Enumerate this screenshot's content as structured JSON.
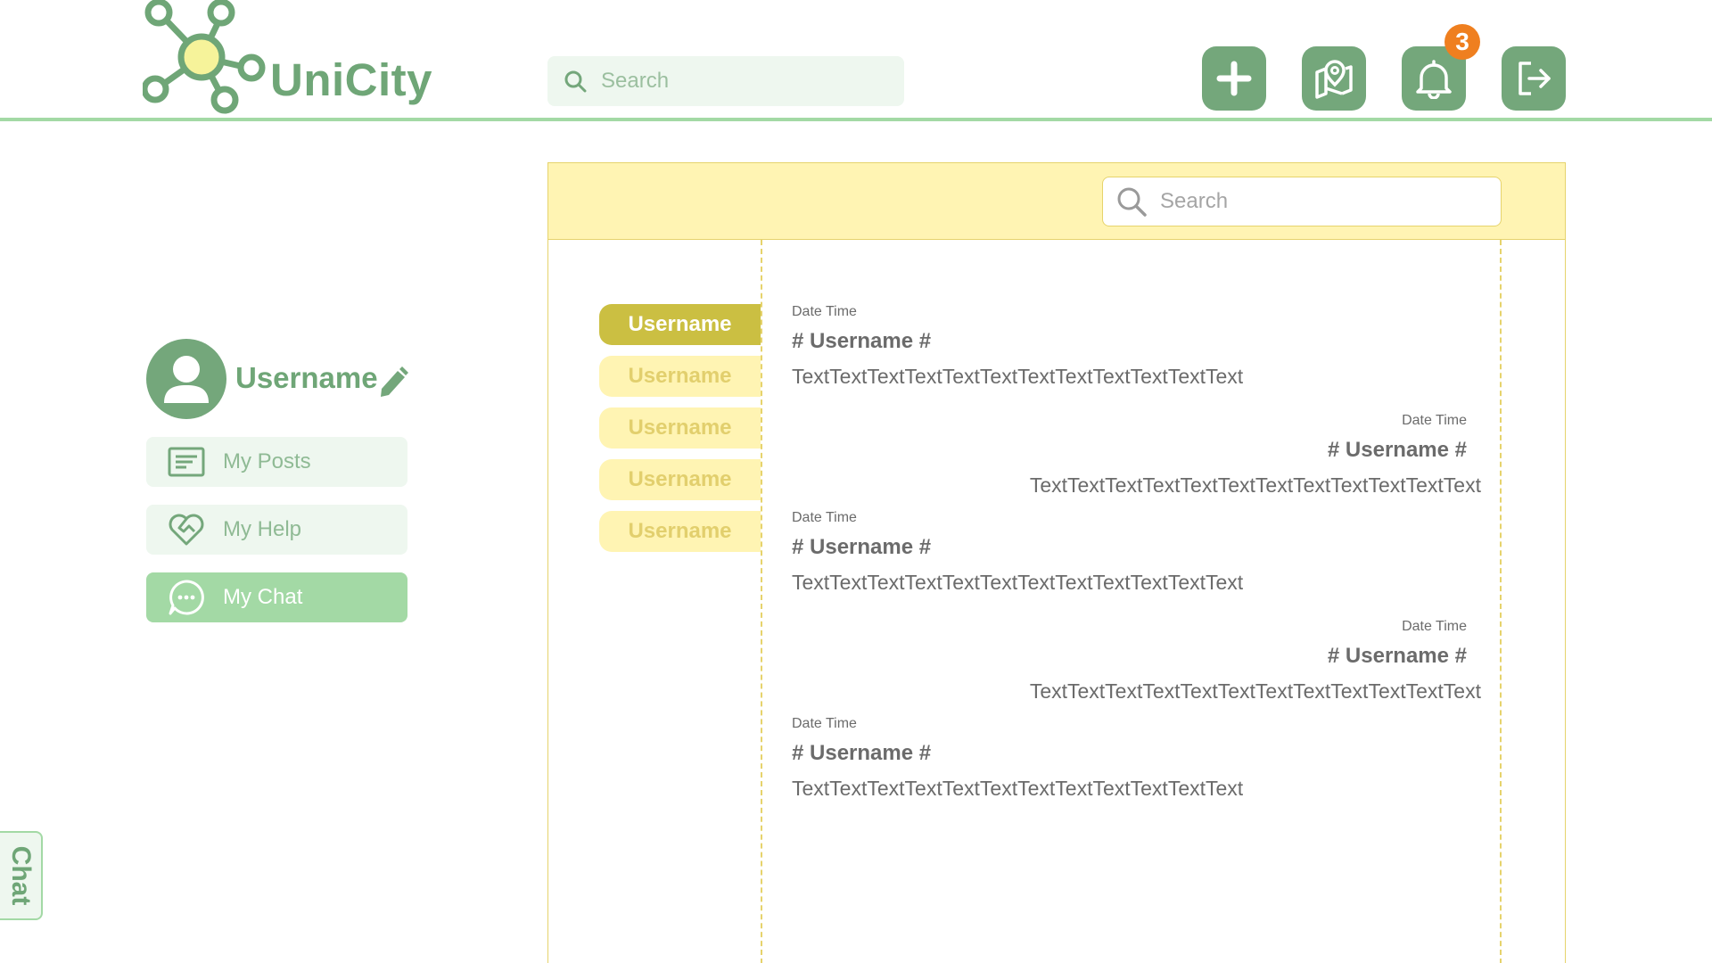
{
  "app": {
    "brand": "UniCity"
  },
  "header": {
    "search_placeholder": "Search",
    "notification_count": "3",
    "buttons": [
      "add-button",
      "map-button",
      "notifications-button",
      "logout-button"
    ]
  },
  "profile": {
    "username": "Username"
  },
  "menu": {
    "items": [
      {
        "label": "My Posts",
        "icon": "posts-icon"
      },
      {
        "label": "My Help",
        "icon": "heart-handshake-icon"
      },
      {
        "label": "My Chat",
        "icon": "chat-bubble-icon",
        "active": true
      }
    ]
  },
  "side_tab": {
    "label": "Chat"
  },
  "chat": {
    "search_placeholder": "Search",
    "users": [
      "Username",
      "Username",
      "Username",
      "Username",
      "Username"
    ],
    "messages": [
      {
        "time": "Date Time",
        "name": "# Username #",
        "text": "TextTextTextTextTextTextTextTextTextTextTextText",
        "side": "left"
      },
      {
        "time": "Date Time",
        "name": "# Username #",
        "text": "TextTextTextTextTextTextTextTextTextTextTextText",
        "side": "right"
      },
      {
        "time": "Date Time",
        "name": "# Username #",
        "text": "TextTextTextTextTextTextTextTextTextTextTextText",
        "side": "left"
      },
      {
        "time": "Date Time",
        "name": "# Username #",
        "text": "TextTextTextTextTextTextTextTextTextTextTextText",
        "side": "right"
      },
      {
        "time": "Date Time",
        "name": "# Username #",
        "text": "TextTextTextTextTextTextTextTextTextTextTextText",
        "side": "left"
      }
    ]
  },
  "colors": {
    "green": "#74a77b",
    "light_green": "#a3d9a5",
    "pale_green": "#eef7ef",
    "yellow": "#fff4b3",
    "dark_yellow": "#cbbf42",
    "badge_orange": "#ef7f1f"
  }
}
